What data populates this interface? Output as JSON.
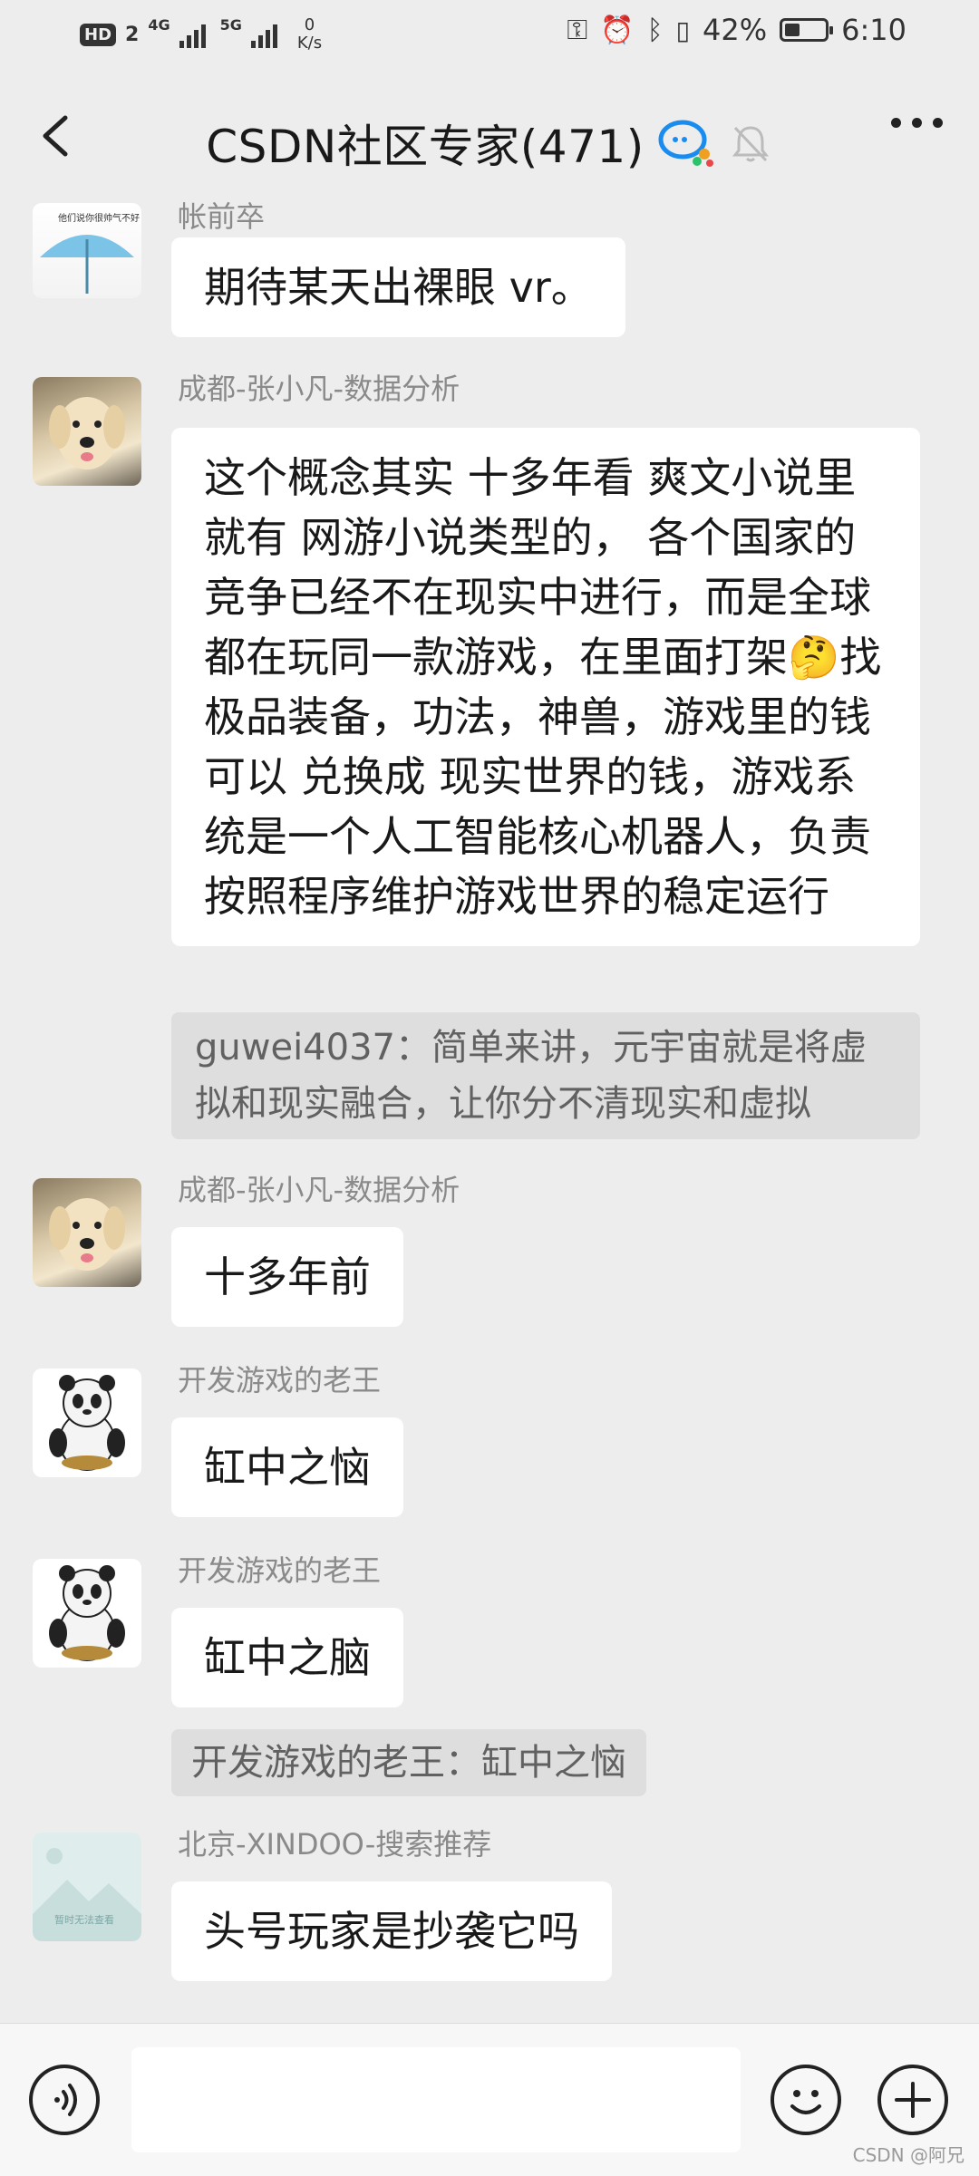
{
  "status_bar": {
    "hd": "HD",
    "sim1": "2",
    "net1": "4G",
    "net2": "5G",
    "speed_value": "0",
    "speed_unit": "K/s",
    "battery": "42%",
    "time": "6:10"
  },
  "header": {
    "title": "CSDN社区专家(471)"
  },
  "messages": [
    {
      "name": "帐前卒",
      "text": "期待某天出裸眼 vr。"
    },
    {
      "name": "成都-张小凡-数据分析",
      "text": "这个概念其实 十多年看 爽文小说里就有  网游小说类型的，   各个国家的竞争已经不在现实中进行，而是全球都在玩同一款游戏，在里面打架🤔找极品装备，功法，神兽，游戏里的钱 可以 兑换成 现实世界的钱，游戏系统是一个人工智能核心机器人，负责按照程序维护游戏世界的稳定运行"
    },
    {
      "name": "",
      "quote": "guwei4037：简单来讲，元宇宙就是将虚拟和现实融合，让你分不清现实和虚拟"
    },
    {
      "name": "成都-张小凡-数据分析",
      "text": "十多年前"
    },
    {
      "name": "开发游戏的老王",
      "text": "缸中之恼"
    },
    {
      "name": "开发游戏的老王",
      "text": "缸中之脑"
    },
    {
      "name": "",
      "quote": "开发游戏的老王：缸中之恼"
    },
    {
      "name": "北京-XINDOO-搜索推荐",
      "text": "头号玩家是抄袭它吗"
    }
  ],
  "avatar_captions": {
    "umbrella": "他们说你很帅气不好",
    "placeholder": "暂时无法查看"
  },
  "watermark": "CSDN @阿兄",
  "icons": [
    "back-arrow-icon",
    "chat-bubble-icon",
    "mute-bell-icon",
    "more-icon",
    "voice-icon",
    "emoji-icon",
    "plus-icon"
  ]
}
